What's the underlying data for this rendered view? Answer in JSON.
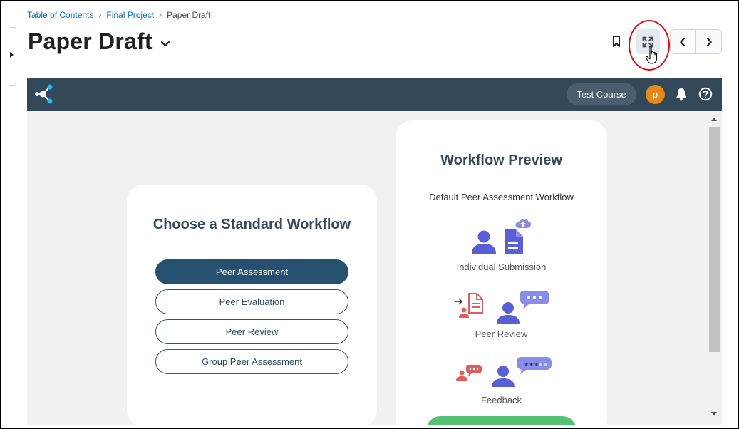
{
  "breadcrumb": {
    "items": [
      "Table of Contents",
      "Final Project"
    ],
    "current": "Paper Draft",
    "separator": "›"
  },
  "page": {
    "title": "Paper Draft"
  },
  "app_header": {
    "course_label": "Test Course",
    "avatar_initial": "p"
  },
  "workflow_chooser": {
    "title": "Choose a Standard Workflow",
    "options": [
      {
        "label": "Peer Assessment",
        "selected": true
      },
      {
        "label": "Peer Evaluation",
        "selected": false
      },
      {
        "label": "Peer Review",
        "selected": false
      },
      {
        "label": "Group Peer Assessment",
        "selected": false
      }
    ]
  },
  "workflow_preview": {
    "title": "Workflow Preview",
    "subtitle": "Default Peer Assessment Workflow",
    "steps": [
      {
        "label": "Individual Submission",
        "icon": "individual-submission-icon"
      },
      {
        "label": "Peer Review",
        "icon": "peer-review-icon"
      },
      {
        "label": "Feedback",
        "icon": "feedback-icon"
      }
    ]
  },
  "colors": {
    "header_bg": "#33495a",
    "primary_button": "#25506f",
    "illustration_purple": "#5b5fd6",
    "illustration_red": "#e05d5d",
    "annotation_red": "#d6101a",
    "green_button": "#55c173"
  }
}
